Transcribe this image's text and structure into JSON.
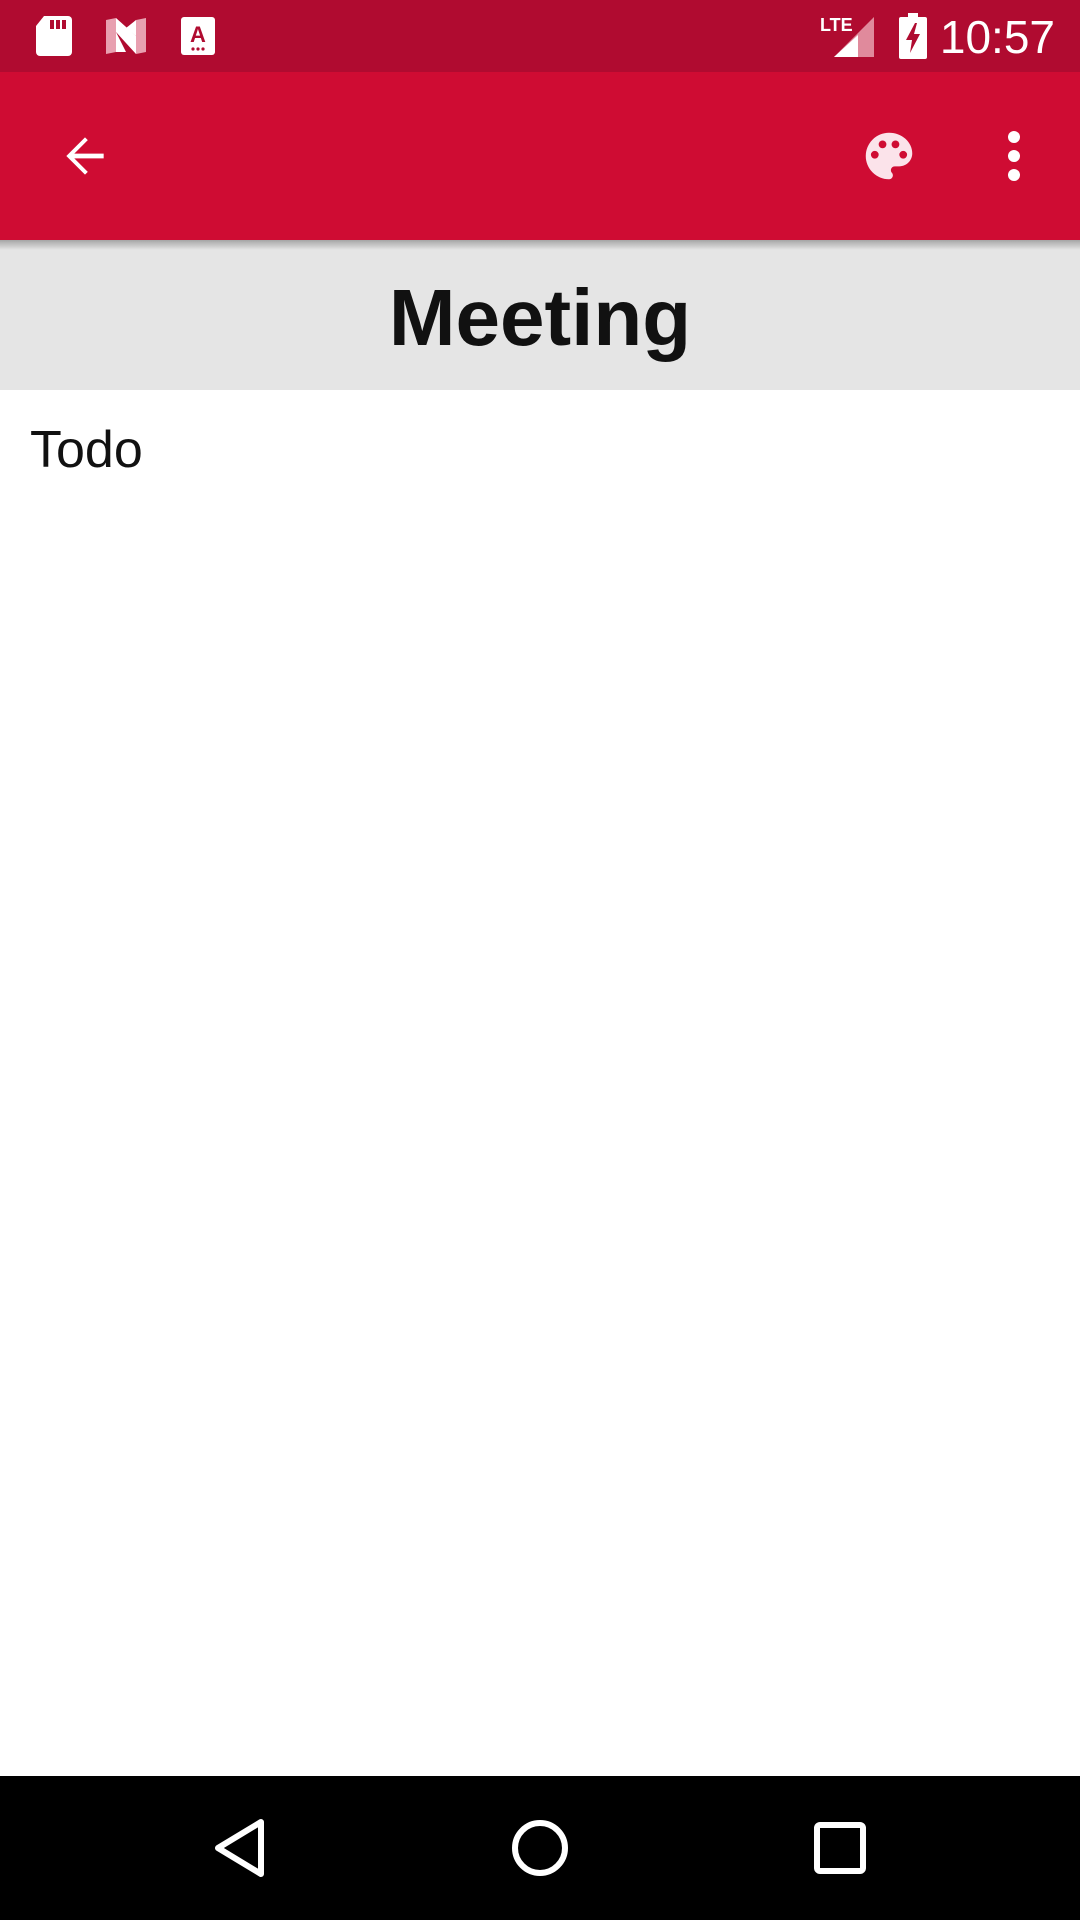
{
  "status_bar": {
    "time": "10:57",
    "network": "LTE",
    "notification_icons": [
      "sd-card-icon",
      "n-app-icon",
      "keyboard-a-icon"
    ],
    "system_icons": [
      "signal-icon",
      "battery-charging-icon"
    ]
  },
  "app_bar": {
    "icons": [
      "back-arrow-icon",
      "palette-icon",
      "overflow-menu-icon"
    ]
  },
  "note": {
    "title": "Meeting",
    "body": "Todo"
  },
  "nav_bar": {
    "icons": [
      "back-triangle-icon",
      "home-circle-icon",
      "recents-square-icon"
    ]
  },
  "colors": {
    "status_bar": "#b00b30",
    "app_bar": "#cf0c33",
    "title_band": "#e5e5e5",
    "nav_bar": "#000000"
  }
}
